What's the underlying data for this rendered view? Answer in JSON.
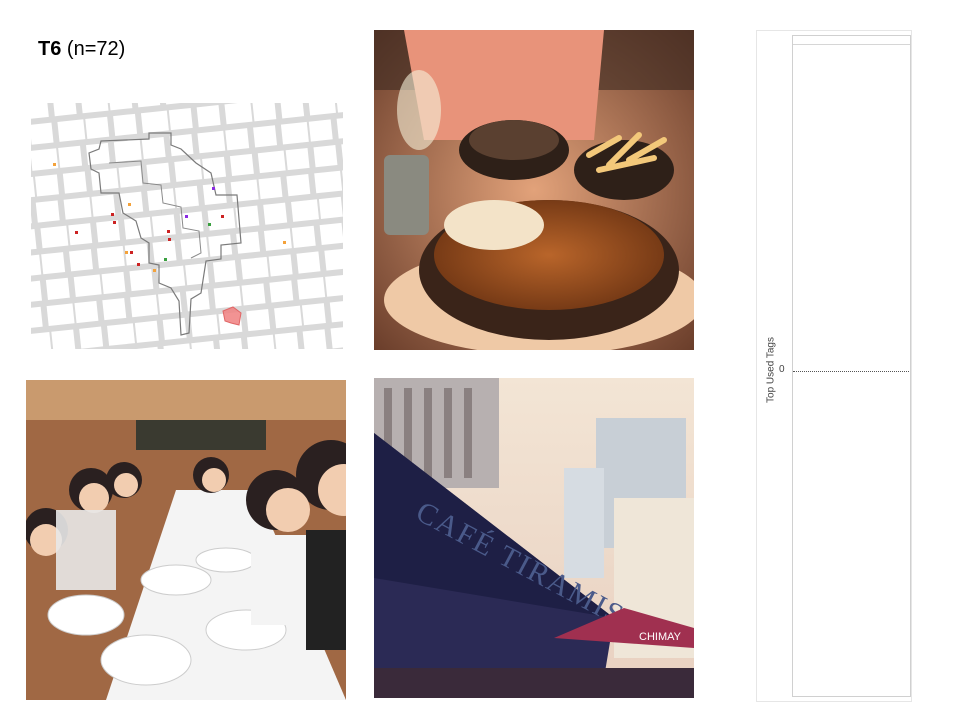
{
  "title": {
    "id": "T6",
    "n_label": "(n=72)"
  },
  "chart_data": {
    "type": "bar",
    "ylabel": "Top Used Tags",
    "categories": [],
    "values": [],
    "y_ticks": [
      "0"
    ],
    "grid": false
  },
  "colors": {
    "map_block": "#ffffff",
    "map_street": "#d9d9d9",
    "route": "#7a7a7a",
    "highlight": "#f08080"
  },
  "map_points": [
    {
      "color": "#f4a23a"
    },
    {
      "color": "#cc2222"
    },
    {
      "color": "#cc2222"
    },
    {
      "color": "#f4a23a"
    },
    {
      "color": "#8a2be2"
    },
    {
      "color": "#cc2222"
    },
    {
      "color": "#3aa040"
    },
    {
      "color": "#cc2222"
    },
    {
      "color": "#cc2222"
    },
    {
      "color": "#f4a23a"
    },
    {
      "color": "#cc2222"
    },
    {
      "color": "#3aa040"
    },
    {
      "color": "#cc2222"
    },
    {
      "color": "#f4a23a"
    },
    {
      "color": "#8a2be2"
    },
    {
      "color": "#cc2222"
    },
    {
      "color": "#f4a23a"
    }
  ],
  "cafe_sign": "CAFÉ TIRAMISU",
  "umbrella_text": "CHIMAY"
}
